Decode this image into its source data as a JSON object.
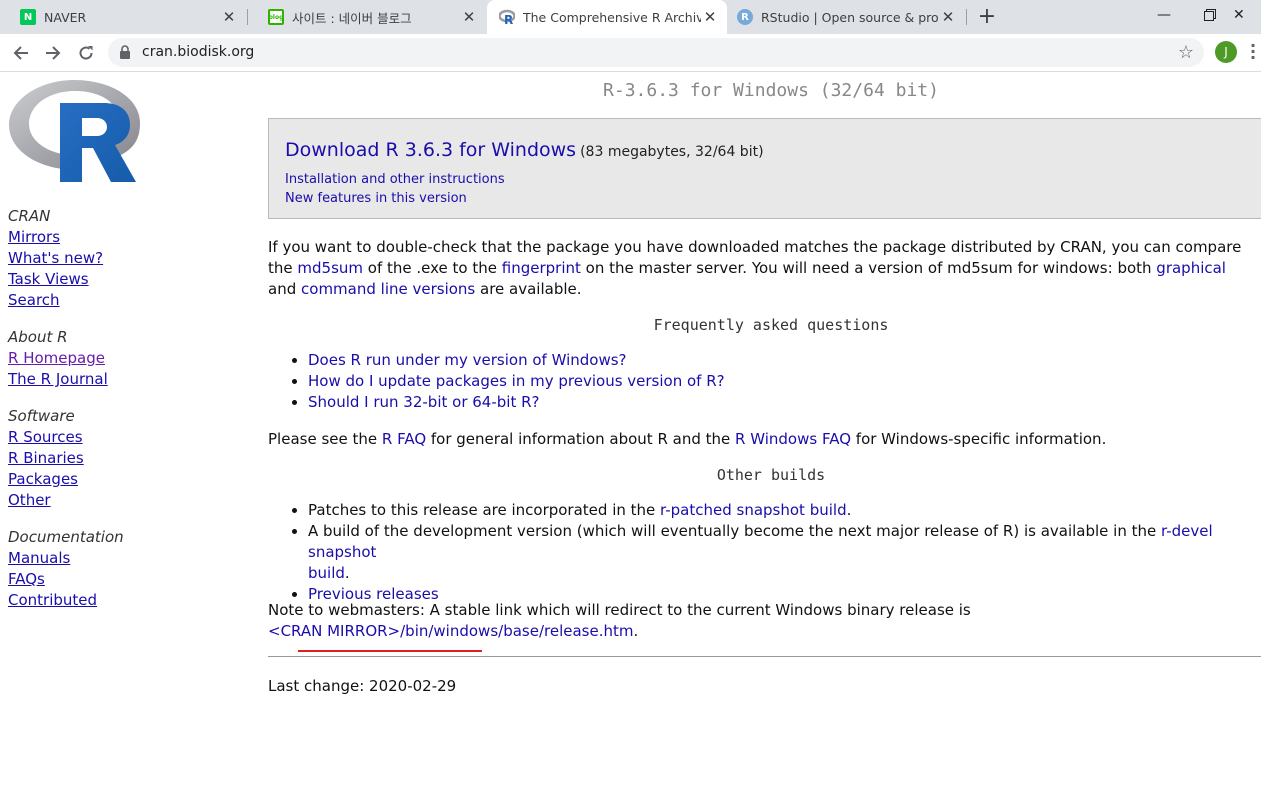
{
  "tabs": [
    {
      "title": "NAVER",
      "active": false
    },
    {
      "title": "사이트 : 네이버 블로그",
      "active": false
    },
    {
      "title": "The Comprehensive R Archive N",
      "active": true
    },
    {
      "title": "RStudio | Open source & profes",
      "active": false
    }
  ],
  "address": {
    "url": "cran.biodisk.org"
  },
  "profile_initial": "J",
  "sidebar": {
    "sections": [
      {
        "heading": "CRAN",
        "links": [
          "Mirrors",
          "What's new?",
          "Task Views",
          "Search"
        ]
      },
      {
        "heading": "About R",
        "links": [
          "R Homepage",
          "The R Journal"
        ]
      },
      {
        "heading": "Software",
        "links": [
          "R Sources",
          "R Binaries",
          "Packages",
          "Other"
        ]
      },
      {
        "heading": "Documentation",
        "links": [
          "Manuals",
          "FAQs",
          "Contributed"
        ]
      }
    ]
  },
  "main": {
    "title": "R-3.6.3 for Windows (32/64 bit)",
    "download": {
      "link": "Download R 3.6.3 for Windows",
      "size": "(83 megabytes, 32/64 bit)",
      "install_link": "Installation and other instructions",
      "features_link": "New features in this version"
    },
    "md5": {
      "p1": "If you want to double-check that the package you have downloaded matches the package distributed by CRAN, you can compare the",
      "md5sum": "md5sum",
      "p2": " of the .exe to the ",
      "fingerprint": "fingerprint",
      "p3": " on the master server. You will need a version of md5sum for windows: both ",
      "graphical": "graphical",
      "p4": " and",
      "cmdline": "command line versions",
      "p5": " are available."
    },
    "faq_heading": "Frequently asked questions",
    "faq_items": [
      "Does R run under my version of Windows?",
      "How do I update packages in my previous version of R?",
      "Should I run 32-bit or 64-bit R?"
    ],
    "see": {
      "p1": "Please see the ",
      "rfaq": "R FAQ",
      "p2": " for general information about R and the ",
      "rwfaq": "R Windows FAQ",
      "p3": " for Windows-specific information."
    },
    "other_heading": "Other builds",
    "other": {
      "patch_text": "Patches to this release are incorporated in the ",
      "patch_link": "r-patched snapshot build",
      "patch_end": ".",
      "devel_text": "A build of the development version (which will eventually become the next major release of R) is available in the ",
      "devel_link1": "r-devel snapshot",
      "devel_link2": "build",
      "devel_end": ".",
      "previous": "Previous releases"
    },
    "webmaster": {
      "text": "Note to webmasters: A stable link which will redirect to the current Windows binary release is",
      "link": "<CRAN MIRROR>/bin/windows/base/release.htm",
      "end": "."
    },
    "last_change": "Last change: 2020-02-29"
  },
  "colors": {
    "link": "#1a0dab",
    "visited": "#681da8",
    "annotation": "#e02020"
  }
}
